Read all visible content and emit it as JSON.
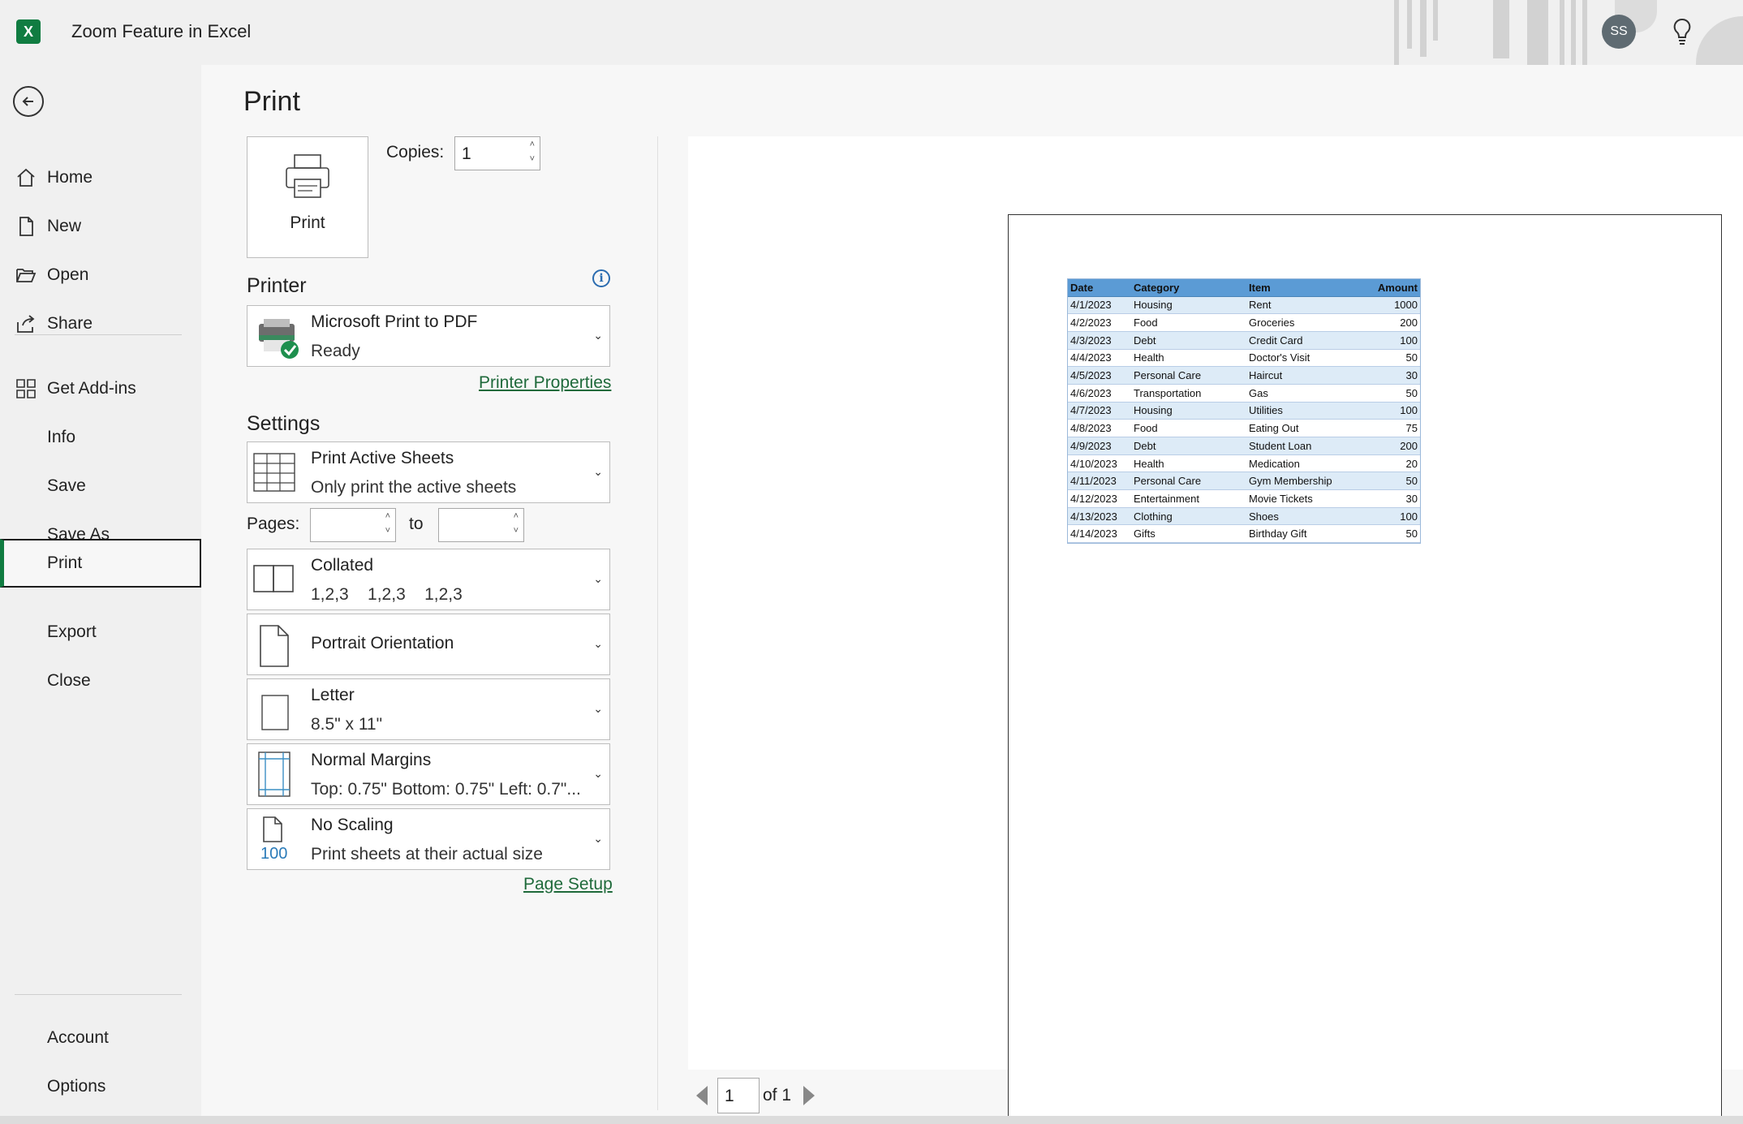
{
  "window": {
    "title": "Zoom Feature in Excel",
    "app_logo": "X",
    "user_initials": "SS"
  },
  "sidebar": {
    "items": [
      {
        "label": "Home",
        "icon": "home-icon"
      },
      {
        "label": "New",
        "icon": "new-document-icon"
      },
      {
        "label": "Open",
        "icon": "folder-open-icon"
      },
      {
        "label": "Share",
        "icon": "share-icon"
      },
      {
        "label": "Get Add-ins",
        "icon": "add-ins-grid-icon"
      },
      {
        "label": "Info"
      },
      {
        "label": "Save"
      },
      {
        "label": "Save As"
      },
      {
        "label": "Print",
        "active": true
      },
      {
        "label": "Export"
      },
      {
        "label": "Close"
      }
    ],
    "bottom_items": [
      {
        "label": "Account"
      },
      {
        "label": "Options"
      }
    ]
  },
  "print": {
    "title": "Print",
    "print_button": "Print",
    "copies_label": "Copies:",
    "copies_value": "1",
    "printer_heading": "Printer",
    "printer_name": "Microsoft Print to PDF",
    "printer_status": "Ready",
    "printer_properties": "Printer Properties",
    "settings_heading": "Settings",
    "settings": {
      "what": {
        "title": "Print Active Sheets",
        "subtitle": "Only print the active sheets"
      },
      "pages_label": "Pages:",
      "pages_from": "",
      "pages_to_label": "to",
      "pages_to": "",
      "collate": {
        "title": "Collated",
        "subtitle": "1,2,3    1,2,3    1,2,3"
      },
      "orientation": {
        "title": "Portrait Orientation"
      },
      "paper": {
        "title": "Letter",
        "subtitle": "8.5\" x 11\""
      },
      "margins": {
        "title": "Normal Margins",
        "subtitle": "Top: 0.75\" Bottom: 0.75\" Left: 0.7\"..."
      },
      "scaling": {
        "title": "No Scaling",
        "subtitle": "Print sheets at their actual size",
        "icon_text": "100"
      }
    },
    "page_setup": "Page Setup"
  },
  "preview": {
    "headers": [
      "Date",
      "Category",
      "Item",
      "Amount"
    ],
    "rows": [
      [
        "4/1/2023",
        "Housing",
        "Rent",
        "1000"
      ],
      [
        "4/2/2023",
        "Food",
        "Groceries",
        "200"
      ],
      [
        "4/3/2023",
        "Debt",
        "Credit Card",
        "100"
      ],
      [
        "4/4/2023",
        "Health",
        "Doctor's Visit",
        "50"
      ],
      [
        "4/5/2023",
        "Personal Care",
        "Haircut",
        "30"
      ],
      [
        "4/6/2023",
        "Transportation",
        "Gas",
        "50"
      ],
      [
        "4/7/2023",
        "Housing",
        "Utilities",
        "100"
      ],
      [
        "4/8/2023",
        "Food",
        "Eating Out",
        "75"
      ],
      [
        "4/9/2023",
        "Debt",
        "Student Loan",
        "200"
      ],
      [
        "4/10/2023",
        "Health",
        "Medication",
        "20"
      ],
      [
        "4/11/2023",
        "Personal Care",
        "Gym Membership",
        "50"
      ],
      [
        "4/12/2023",
        "Entertainment",
        "Movie Tickets",
        "30"
      ],
      [
        "4/13/2023",
        "Clothing",
        "Shoes",
        "100"
      ],
      [
        "4/14/2023",
        "Gifts",
        "Birthday Gift",
        "50"
      ]
    ],
    "current_page": "1",
    "of_pages": "of 1"
  },
  "colors": {
    "excel_green": "#107c41",
    "link_green": "#1f6a3b",
    "table_header": "#5b9bd5",
    "table_band": "#ddebf7"
  }
}
